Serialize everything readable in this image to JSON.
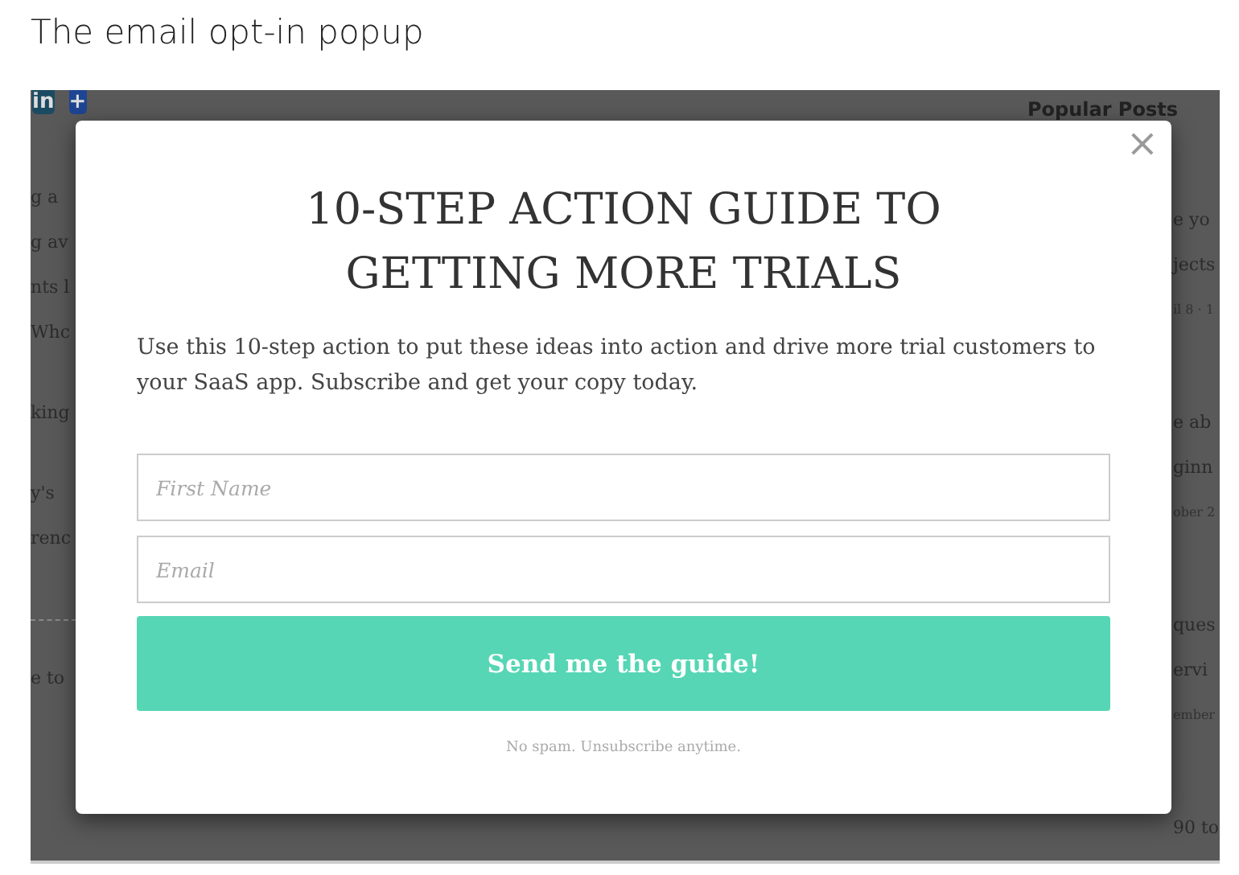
{
  "caption": "The email opt-in popup",
  "background": {
    "share_buttons": [
      "in",
      "+"
    ],
    "left_paragraphs": [
      [
        "g a",
        "g av",
        "nts l",
        "Whc"
      ],
      [
        "king"
      ],
      [
        "y's",
        "renc"
      ],
      [
        "e to"
      ]
    ],
    "sidebar": {
      "title": "Popular Posts",
      "posts": [
        {
          "lines": [
            "e yo",
            "jects"
          ],
          "date": "il 8 · 1"
        },
        {
          "lines": [
            "e ab",
            "ginn"
          ],
          "date": "ober 2"
        },
        {
          "lines": [
            "ques",
            "ervi"
          ],
          "date": "ember"
        },
        {
          "lines": [
            "90 to"
          ]
        }
      ]
    }
  },
  "popup": {
    "close": "×",
    "title": "10-STEP ACTION GUIDE TO GETTING MORE TRIALS",
    "text": "Use this 10-step action to put these ideas into action and drive more trial customers to your SaaS app. Subscribe and get your copy today.",
    "fields": [
      {
        "placeholder": "First Name"
      },
      {
        "placeholder": "Email"
      }
    ],
    "button": "Send me the guide!",
    "note": "No spam. Unsubscribe anytime."
  }
}
